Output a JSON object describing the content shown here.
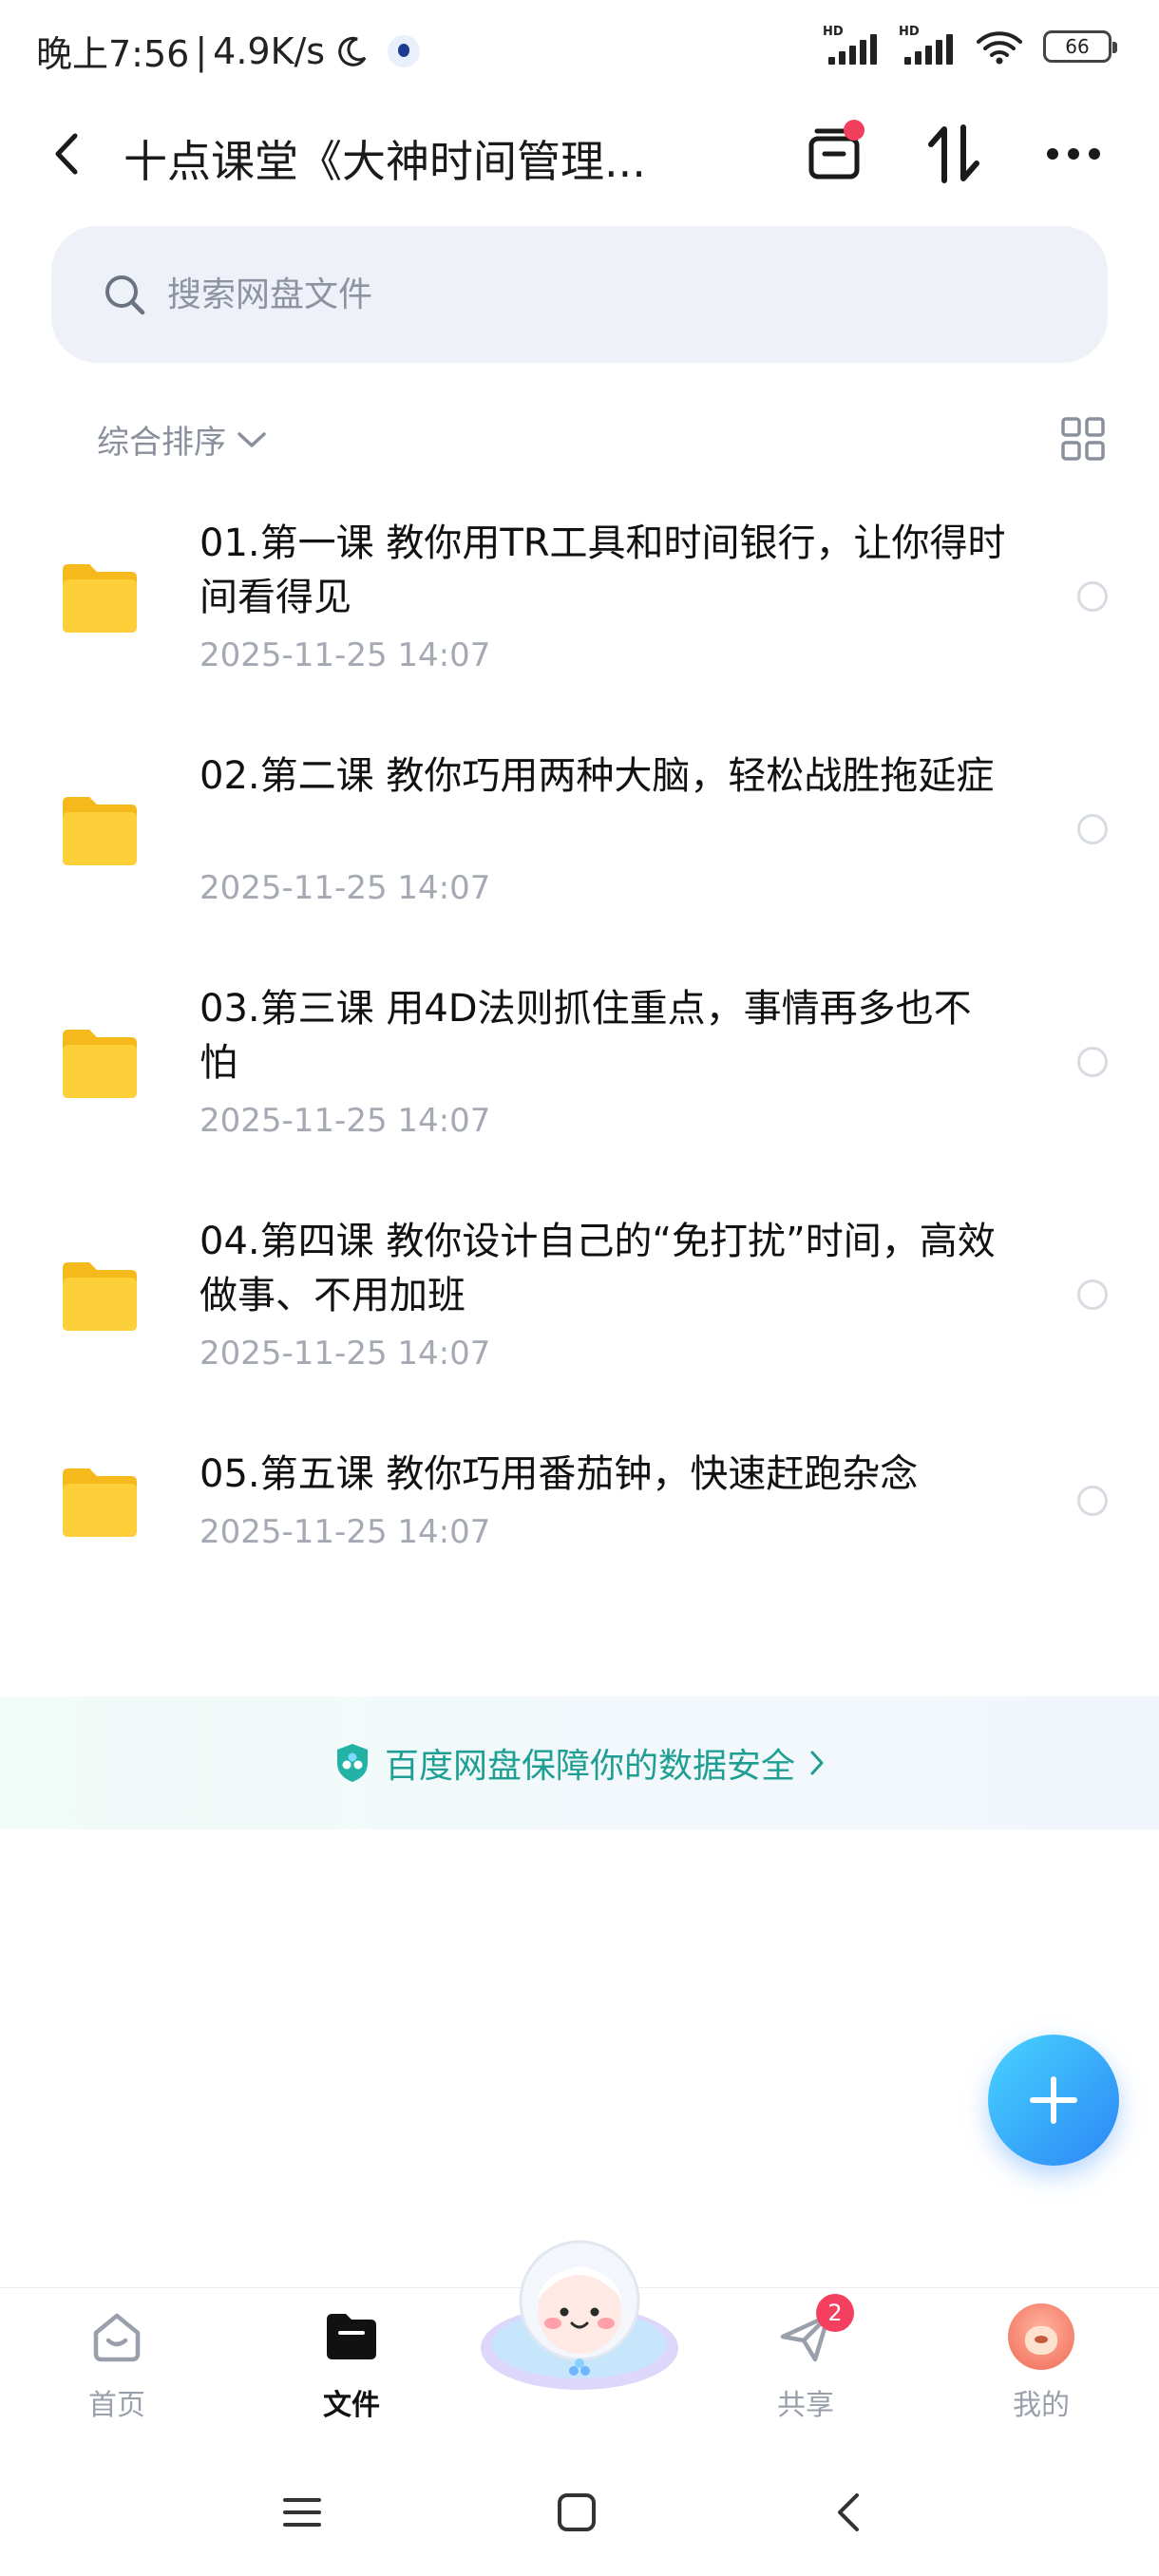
{
  "status_bar": {
    "time": "晚上7:56",
    "speed": "4.9K/s",
    "hd_label": "HD",
    "battery": "66"
  },
  "header": {
    "title": "十点课堂《大神时间管理...",
    "icons": [
      "back-arrow",
      "transfer-list",
      "sort-arrows",
      "more-dots"
    ]
  },
  "search": {
    "placeholder": "搜索网盘文件"
  },
  "sort": {
    "label": "综合排序"
  },
  "files": [
    {
      "name": "01.第一课 教你用TR工具和时间银行，让你得时间看得见",
      "date": "2025-11-25  14:07"
    },
    {
      "name": "02.第二课 教你巧用两种大脑，轻松战胜拖延症",
      "date": "2025-11-25  14:07"
    },
    {
      "name": "03.第三课 用4D法则抓住重点，事情再多也不怕",
      "date": "2025-11-25  14:07"
    },
    {
      "name": "04.第四课 教你设计自己的“免打扰”时间，高效做事、不用加班",
      "date": "2025-11-25  14:07"
    },
    {
      "name": "05.第五课 教你巧用番茄钟，快速赶跑杂念",
      "date": "2025-11-25  14:07"
    }
  ],
  "security_banner": {
    "text": "百度网盘保障你的数据安全"
  },
  "bottom_nav": {
    "home": "首页",
    "files": "文件",
    "share": "共享",
    "share_badge": "2",
    "mine": "我的"
  },
  "colors": {
    "accent": "#2b86f5",
    "security_text": "#1f9f93",
    "badge": "#f43f5e",
    "folder": "#fcc72e"
  }
}
